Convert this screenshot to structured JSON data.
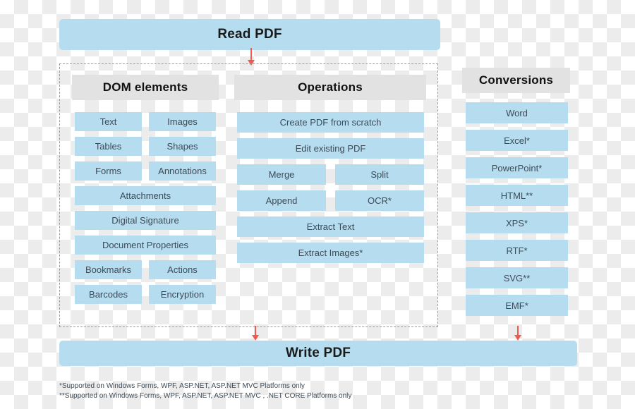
{
  "diagram": {
    "top_bar": {
      "label": "Read PDF"
    },
    "bottom_bar": {
      "label": "Write PDF"
    },
    "groups": [
      {
        "id": "dom-elements",
        "title": "DOM elements",
        "items": [
          {
            "label": "Text",
            "span": "half-left"
          },
          {
            "label": "Images",
            "span": "half-right"
          },
          {
            "label": "Tables",
            "span": "half-left"
          },
          {
            "label": "Shapes",
            "span": "half-right"
          },
          {
            "label": "Forms",
            "span": "half-left"
          },
          {
            "label": "Annotations",
            "span": "half-right"
          },
          {
            "label": "Attachments",
            "span": "full"
          },
          {
            "label": "Digital Signature",
            "span": "full"
          },
          {
            "label": "Document Properties",
            "span": "full"
          },
          {
            "label": "Bookmarks",
            "span": "half-left"
          },
          {
            "label": "Actions",
            "span": "half-right"
          },
          {
            "label": "Barcodes",
            "span": "half-left"
          },
          {
            "label": "Encryption",
            "span": "half-right"
          }
        ]
      },
      {
        "id": "operations",
        "title": "Operations",
        "items": [
          {
            "label": "Create PDF from scratch",
            "span": "full"
          },
          {
            "label": "Edit existing PDF",
            "span": "full"
          },
          {
            "label": "Merge",
            "span": "half-left"
          },
          {
            "label": "Split",
            "span": "half-right"
          },
          {
            "label": "Append",
            "span": "half-left"
          },
          {
            "label": "OCR*",
            "span": "half-right"
          },
          {
            "label": "Extract Text",
            "span": "full"
          },
          {
            "label": "Extract Images*",
            "span": "full"
          }
        ]
      },
      {
        "id": "conversions",
        "title": "Conversions",
        "items": [
          {
            "label": "Word",
            "span": "full"
          },
          {
            "label": "Excel*",
            "span": "full"
          },
          {
            "label": "PowerPoint*",
            "span": "full"
          },
          {
            "label": "HTML**",
            "span": "full"
          },
          {
            "label": "XPS*",
            "span": "full"
          },
          {
            "label": "RTF*",
            "span": "full"
          },
          {
            "label": "SVG**",
            "span": "full"
          },
          {
            "label": "EMF*",
            "span": "full"
          }
        ]
      }
    ],
    "footnotes": [
      "*Supported on Windows Forms, WPF, ASP.NET, ASP.NET MVC Platforms only",
      "**Supported on Windows Forms, WPF, ASP.NET, ASP.NET MVC , .NET CORE Platforms only"
    ],
    "colors": {
      "box_fill": "#b5ddef",
      "header_fill": "#e2e2e2",
      "arrow": "#f05a50",
      "text": "#3d4b57",
      "dashed_border": "#9a9a9a"
    }
  }
}
